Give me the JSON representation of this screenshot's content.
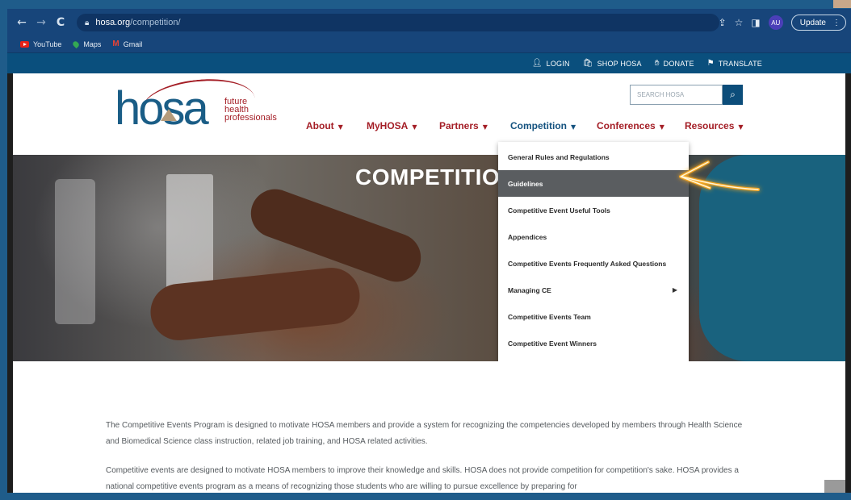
{
  "browser": {
    "back": "←",
    "forward": "→",
    "reload": "C",
    "url_host": "hosa.org",
    "url_path": "/competition/",
    "avatar": "AU",
    "update_label": "Update",
    "bookmarks": [
      {
        "label": "YouTube",
        "icon": "youtube-icon"
      },
      {
        "label": "Maps",
        "icon": "maps-icon"
      },
      {
        "label": "Gmail",
        "icon": "gmail-icon"
      }
    ]
  },
  "utility": {
    "login": "LOGIN",
    "shop": "SHOP HOSA",
    "donate": "DONATE",
    "translate": "TRANSLATE"
  },
  "logo": {
    "wordmark": "hosa",
    "tagline_1": "future",
    "tagline_2": "health",
    "tagline_3": "professionals"
  },
  "search": {
    "placeholder": "SEARCH HOSA"
  },
  "nav": {
    "about": "About",
    "myhosa": "MyHOSA",
    "partners": "Partners",
    "competition": "Competition",
    "conferences": "Conferences",
    "resources": "Resources"
  },
  "hero": {
    "title": "COMPETITIO"
  },
  "dropdown": [
    "General Rules and Regulations",
    "Guidelines",
    "Competitive Event Useful Tools",
    "Appendices",
    "Competitive Events Frequently Asked Questions",
    "Managing CE",
    "Competitive Events Team",
    "Competitive Event Winners"
  ],
  "content": {
    "p1": "The Competitive Events Program is designed to motivate HOSA members and provide a system for recognizing the competencies developed by members through Health Science and Biomedical Science class instruction, related job training, and HOSA related activities.",
    "p2": "Competitive events are designed to motivate HOSA members to improve their knowledge and skills.  HOSA does not provide competition for competition's sake. HOSA provides a national competitive events program as a means of recognizing those students who are willing to pursue excellence by preparing for"
  },
  "colors": {
    "brand_red": "#a41e26",
    "brand_blue": "#0c4d7a",
    "highlight_arrow": "#f5a623"
  }
}
